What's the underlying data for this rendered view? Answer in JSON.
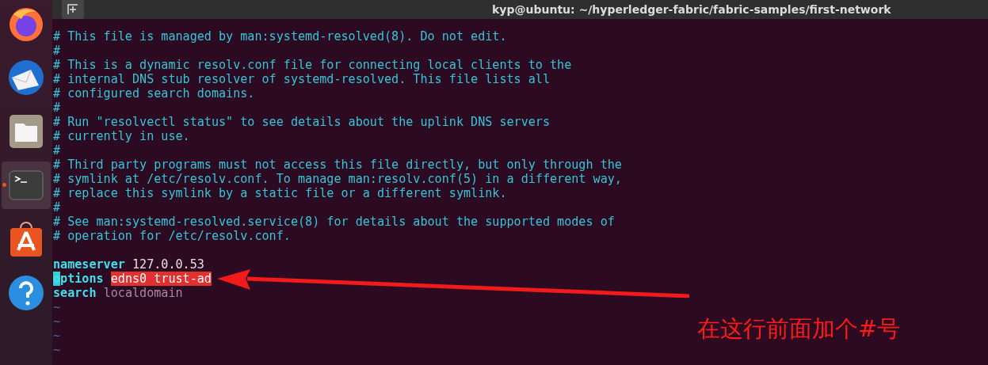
{
  "dock": [
    {
      "kind": "browser",
      "selected": false,
      "running": false
    },
    {
      "kind": "mail",
      "selected": false,
      "running": false
    },
    {
      "kind": "files",
      "selected": false,
      "running": false
    },
    {
      "kind": "terminal",
      "selected": true,
      "running": true
    },
    {
      "kind": "store",
      "selected": false,
      "running": false
    },
    {
      "kind": "help",
      "selected": false,
      "running": false
    }
  ],
  "window": {
    "title": "kyp@ubuntu: ~/hyperledger-fabric/fabric-samples/first-network"
  },
  "lines": [
    {
      "kind": "comment",
      "text": "# This file is managed by man:systemd-resolved(8). Do not edit."
    },
    {
      "kind": "comment",
      "text": "#"
    },
    {
      "kind": "comment",
      "text": "# This is a dynamic resolv.conf file for connecting local clients to the"
    },
    {
      "kind": "comment",
      "text": "# internal DNS stub resolver of systemd-resolved. This file lists all"
    },
    {
      "kind": "comment",
      "text": "# configured search domains."
    },
    {
      "kind": "comment",
      "text": "#"
    },
    {
      "kind": "comment",
      "text": "# Run \"resolvectl status\" to see details about the uplink DNS servers"
    },
    {
      "kind": "comment",
      "text": "# currently in use."
    },
    {
      "kind": "comment",
      "text": "#"
    },
    {
      "kind": "comment",
      "text": "# Third party programs must not access this file directly, but only through the"
    },
    {
      "kind": "comment",
      "text": "# symlink at /etc/resolv.conf. To manage man:resolv.conf(5) in a different way,"
    },
    {
      "kind": "comment",
      "text": "# replace this symlink by a static file or a different symlink."
    },
    {
      "kind": "comment",
      "text": "#"
    },
    {
      "kind": "comment",
      "text": "# See man:systemd-resolved.service(8) for details about the supported modes of"
    },
    {
      "kind": "comment",
      "text": "# operation for /etc/resolv.conf."
    },
    {
      "kind": "blank"
    },
    {
      "kind": "directive",
      "keyword": "nameserver",
      "value": {
        "text": "127.0.0.53",
        "kind": "number"
      },
      "cursor": false,
      "highlighted": false
    },
    {
      "kind": "directive",
      "keyword": "options",
      "value": {
        "text": "edns0 trust-ad",
        "kind": "plain"
      },
      "cursor": true,
      "highlighted": true
    },
    {
      "kind": "directive",
      "keyword": "search",
      "value": {
        "text": "localdomain",
        "kind": "identifier"
      },
      "cursor": false,
      "highlighted": false
    },
    {
      "kind": "tilde",
      "text": "~"
    },
    {
      "kind": "tilde",
      "text": "~"
    },
    {
      "kind": "tilde",
      "text": "~"
    },
    {
      "kind": "tilde",
      "text": "~"
    }
  ],
  "annotation": {
    "text": "在这行前面加个#号"
  }
}
